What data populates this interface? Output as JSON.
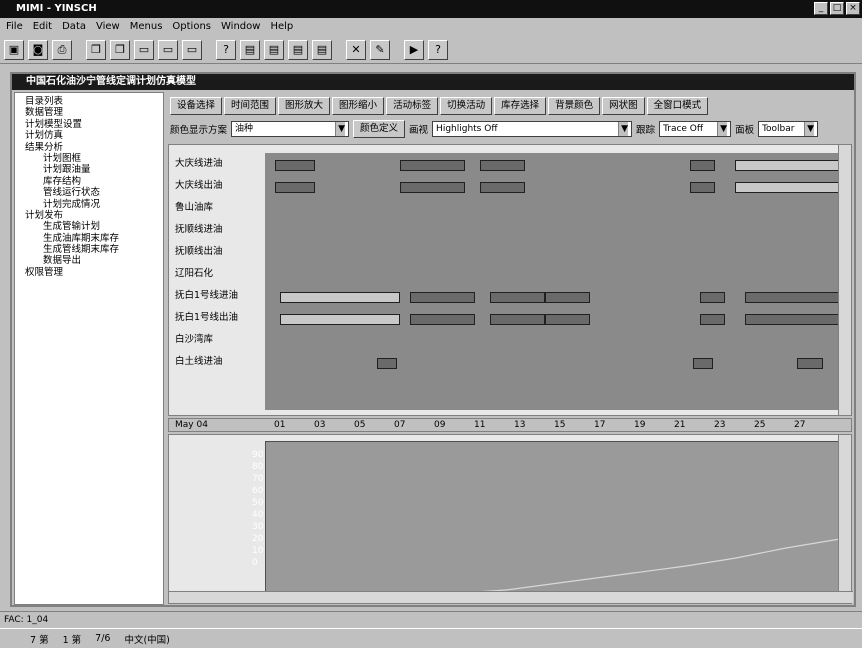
{
  "window": {
    "title": "MIMI - YINSCH"
  },
  "menu": [
    "File",
    "Edit",
    "Data",
    "View",
    "Menus",
    "Options",
    "Window",
    "Help"
  ],
  "toolbar_icons": [
    "save-icon",
    "disk-icon",
    "print-icon",
    "copy-icon",
    "copy-icon",
    "window-icon",
    "window-icon",
    "window-icon",
    "help-icon",
    "chart-icon",
    "chart-icon",
    "chart-icon",
    "chart-icon",
    "close-icon",
    "edit-icon",
    "run-icon",
    "help-icon"
  ],
  "child": {
    "title": "中国石化油沙宁管线定调计划仿真模型"
  },
  "tree": [
    "目录列表",
    "数据管理",
    "计划模型设置",
    "计划仿真",
    "结果分析",
    "计划图框",
    "计划跟油量",
    "库存结构",
    "管线运行状态",
    "计划完成情况",
    "计划发布",
    "生成管输计划",
    "生成油库期末库存",
    "生成管线期末库存",
    "数据导出",
    "权限管理"
  ],
  "buttons": [
    "设备选择",
    "时间范围",
    "图形放大",
    "图形缩小",
    "活动标签",
    "切换活动",
    "库存选择",
    "背景颜色",
    "网状图",
    "全窗口模式"
  ],
  "options": {
    "color_label": "颜色显示方案",
    "color_value": "油种",
    "color_def_btn": "颜色定义",
    "mode_label": "画视",
    "highlight_value": "Highlights Off",
    "trace_label": "跟踪",
    "trace_value": "Trace Off",
    "panel_label": "面板",
    "panel_value": "Toolbar"
  },
  "gantt_rows": [
    "大庆线进油",
    "大庆线出油",
    "鲁山油库",
    "抚顺线进油",
    "抚顺线出油",
    "辽阳石化",
    "抚白1号线进油",
    "抚白1号线出油",
    "白沙湾库",
    "白土线进油"
  ],
  "axis": {
    "month": "May 04",
    "days": [
      "01",
      "03",
      "05",
      "07",
      "09",
      "11",
      "13",
      "15",
      "17",
      "19",
      "21",
      "23",
      "25",
      "27"
    ]
  },
  "lower_ticks": [
    "90",
    "80",
    "70",
    "60",
    "50",
    "40",
    "30",
    "20",
    "10",
    "0"
  ],
  "status": {
    "left": "FAC: 1_04"
  },
  "taskbar": [
    "7 第",
    "1 第",
    "7/6",
    "中文(中国)"
  ]
}
